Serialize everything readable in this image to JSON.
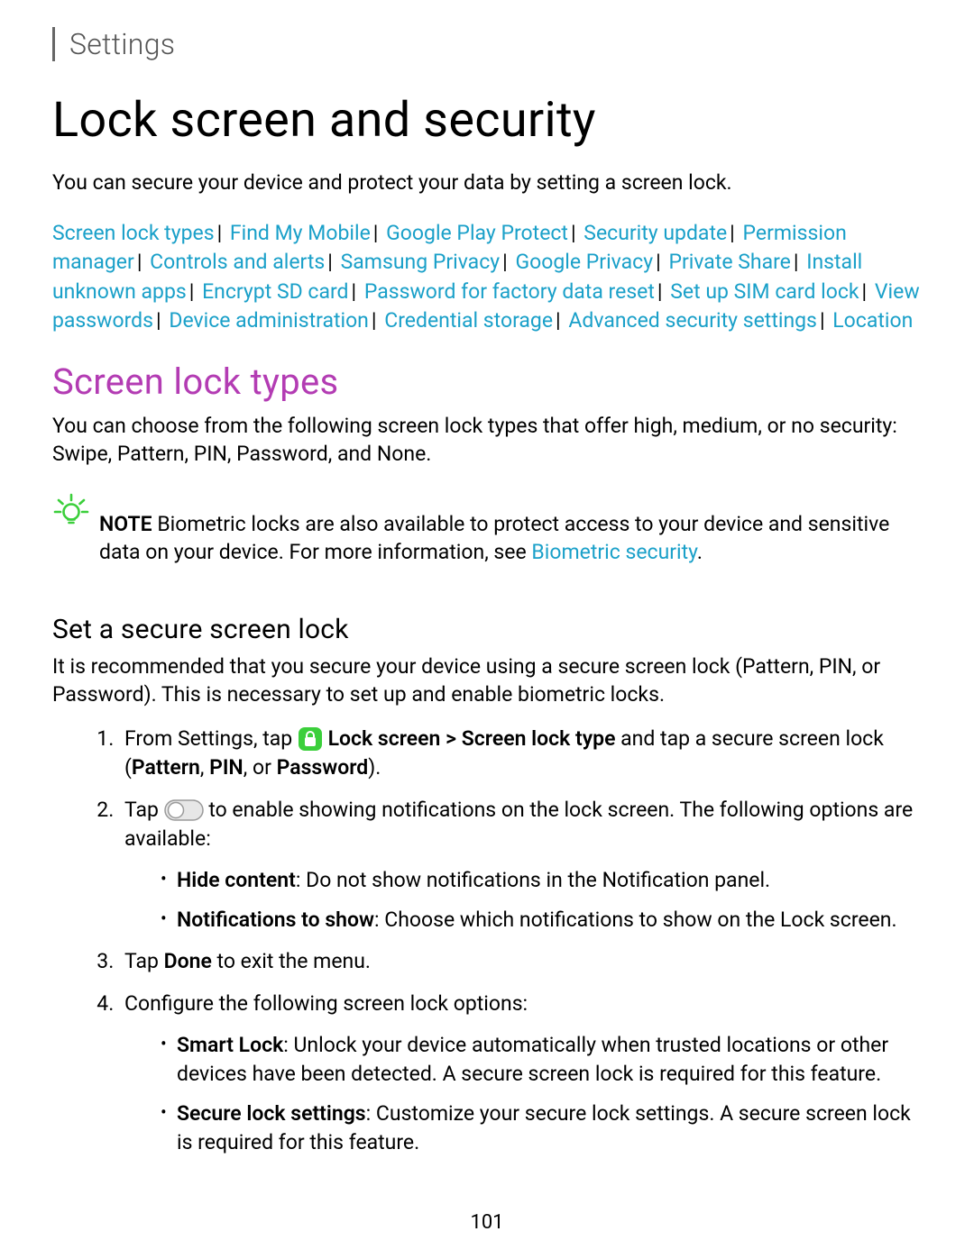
{
  "breadcrumb": "Settings",
  "title": "Lock screen and security",
  "intro": "You can secure your device and protect your data by setting a screen lock.",
  "links": [
    "Screen lock types",
    "Find My Mobile",
    "Google Play Protect",
    "Security update",
    "Permission manager",
    "Controls and alerts",
    "Samsung Privacy",
    "Google Privacy",
    "Private Share",
    "Install unknown apps",
    "Encrypt SD card",
    "Password for factory data reset",
    "Set up SIM card lock",
    "View passwords",
    "Device administration",
    "Credential storage",
    "Advanced security settings",
    "Location"
  ],
  "section": {
    "title": "Screen lock types",
    "intro": "You can choose from the following screen lock types that offer high, medium, or no security: Swipe, Pattern, PIN, Password, and None.",
    "note": {
      "label": "NOTE",
      "text_before_link": "  Biometric locks are also available to protect access to your device and sensitive data on your device. For more information, see ",
      "link": "Biometric security",
      "text_after_link": "."
    },
    "subsection": {
      "title": "Set a secure screen lock",
      "intro": "It is recommended that you secure your device using a secure screen lock (Pattern, PIN, or Password). This is necessary to set up and enable biometric locks.",
      "step1": {
        "pre": "From Settings, tap ",
        "bold1": "Lock screen",
        "gt": " > ",
        "bold2": "Screen lock type",
        "mid": " and tap a secure screen lock (",
        "b_pattern": "Pattern",
        "c1": ", ",
        "b_pin": "PIN",
        "c2": ", or ",
        "b_pw": "Password",
        "end": ")."
      },
      "step2": {
        "pre": "Tap ",
        "post": " to enable showing notifications on the lock screen. The following options are available:",
        "bullets": [
          {
            "bold": "Hide content",
            "rest": ": Do not show notifications in the Notification panel."
          },
          {
            "bold": "Notifications to show",
            "rest": ": Choose which notifications to show on the Lock screen."
          }
        ]
      },
      "step3": {
        "pre": "Tap ",
        "bold": "Done",
        "post": " to exit the menu."
      },
      "step4": {
        "text": "Configure the following screen lock options:",
        "bullets": [
          {
            "bold": "Smart Lock",
            "rest": ": Unlock your device automatically when trusted locations or other devices have been detected. A secure screen lock is required for this feature."
          },
          {
            "bold": "Secure lock settings",
            "rest": ": Customize your secure lock settings. A secure screen lock is required for this feature."
          }
        ]
      }
    }
  },
  "page_number": "101"
}
